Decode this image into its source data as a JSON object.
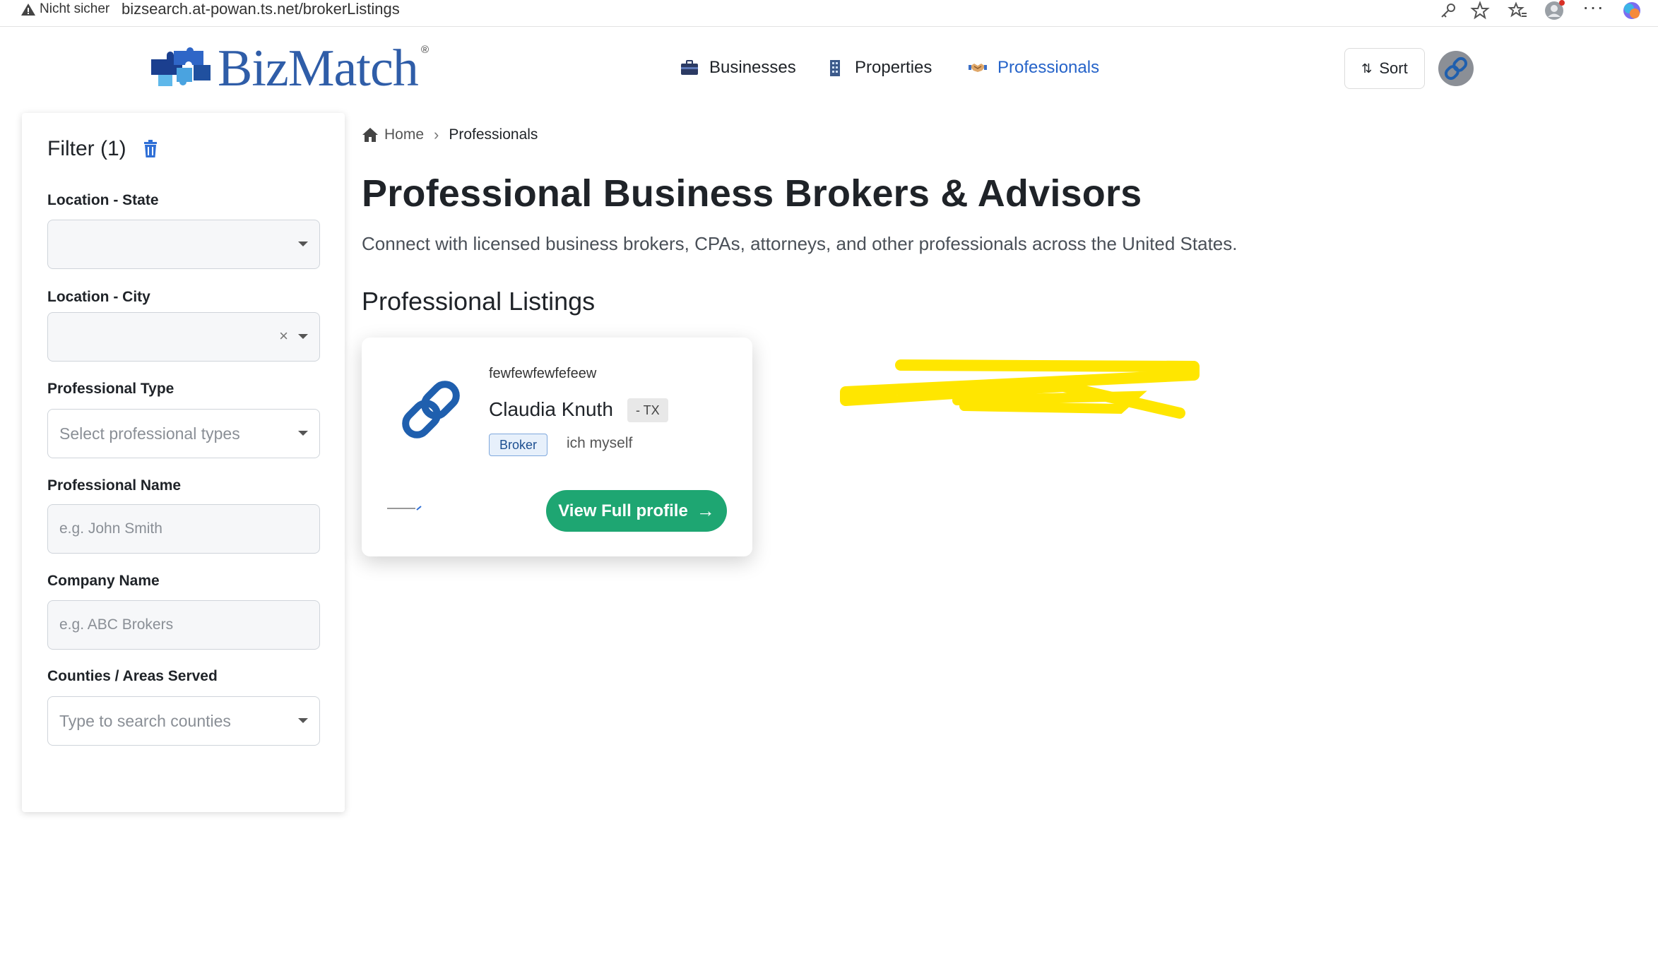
{
  "browser": {
    "security_label": "Nicht sicher",
    "url": "bizsearch.at-powan.ts.net/brokerListings",
    "more_label": "···"
  },
  "header": {
    "logo_text": "BizMatch",
    "logo_reg": "®",
    "nav": [
      {
        "label": "Businesses",
        "icon": "briefcase-icon"
      },
      {
        "label": "Properties",
        "icon": "building-icon"
      },
      {
        "label": "Professionals",
        "icon": "handshake-icon",
        "active": true
      }
    ],
    "sort_label": "Sort"
  },
  "filter": {
    "title": "Filter (1)",
    "fields": [
      {
        "label": "Location - State",
        "placeholder": "",
        "type": "select"
      },
      {
        "label": "Location - City",
        "placeholder": "",
        "type": "select-clearable",
        "clear": "×"
      },
      {
        "label": "Professional Type",
        "placeholder": "Select professional types",
        "type": "select"
      },
      {
        "label": "Professional Name",
        "placeholder": "e.g. John Smith",
        "type": "input"
      },
      {
        "label": "Company Name",
        "placeholder": "e.g. ABC Brokers",
        "type": "input"
      },
      {
        "label": "Counties / Areas Served",
        "placeholder": "Type to search counties",
        "type": "select"
      }
    ]
  },
  "breadcrumb": {
    "home": "Home",
    "current": "Professionals"
  },
  "main": {
    "title": "Professional Business Brokers & Advisors",
    "subtitle": "Connect with licensed business brokers, CPAs, attorneys, and other professionals across the United States.",
    "section_title": "Professional Listings"
  },
  "listing": {
    "company": "fewfewfewfefeew",
    "name": "Claudia Knuth",
    "state": "- TX",
    "type_badge": "Broker",
    "description": "ich myself",
    "button_label": "View Full profile",
    "button_arrow": "→"
  },
  "colors": {
    "accent_blue": "#2563c9",
    "button_green": "#1ea672",
    "brand_blue": "#2f5da8",
    "scribble_yellow": "#ffe600"
  }
}
